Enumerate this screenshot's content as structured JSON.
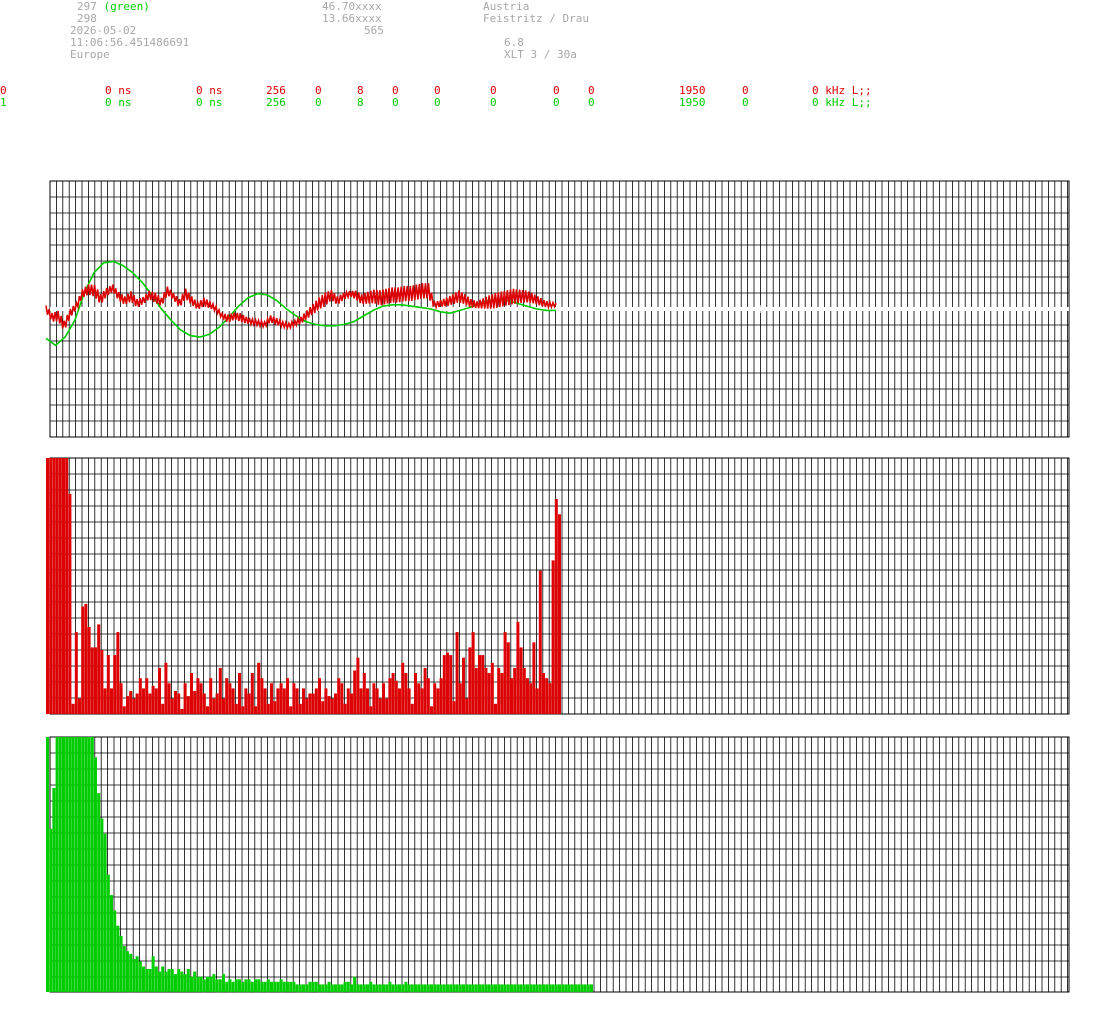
{
  "header": {
    "col1": [
      {
        "text": "297",
        "suffix": "(green)"
      },
      {
        "text": "298"
      },
      {
        "text": "2026-05-02"
      },
      {
        "text": "11:06:56.451486691"
      },
      {
        "text": "Europe"
      }
    ],
    "col2": [
      "46.70xxxx",
      "13.66xxxx",
      "565"
    ],
    "col3": [
      "Austria",
      "Feistritz / Drau",
      "",
      "6.8",
      "XLT 3 / 30a"
    ]
  },
  "channels": [
    {
      "id": "0",
      "d1": "0 ns",
      "d2": "0 ns",
      "n": "256",
      "a": "0",
      "b": "8",
      "c": "0",
      "d": "0",
      "e": "0",
      "f": "0",
      "g": "0",
      "h": "1950",
      "i": "0",
      "freq": "0 kHz L;;",
      "color": "#dd0000"
    },
    {
      "id": "1",
      "d1": "0 ns",
      "d2": "0 ns",
      "n": "256",
      "a": "0",
      "b": "8",
      "c": "0",
      "d": "0",
      "e": "0",
      "f": "0",
      "g": "0",
      "h": "1950",
      "i": "0",
      "freq": "0 kHz L;;",
      "color": "#00cc00"
    }
  ],
  "chart_data": [
    {
      "type": "line",
      "grid": true,
      "series": [
        {
          "color": "#dd0000",
          "values": [
            0,
            -0.6,
            -0.5,
            -1.2,
            -0.3,
            0.2,
            1.1,
            1.4,
            1.3,
            0.7,
            1.2,
            1.5,
            0.9,
            0.6,
            0.9,
            0.4,
            0.6,
            1.0,
            0.8,
            0.5,
            1.3,
            0.9,
            0.4,
            1.1,
            0.6,
            0.2,
            0.5,
            0.3,
            0.0,
            -0.5,
            -0.7,
            -0.5,
            -0.6,
            -0.8,
            -0.9,
            -1.0,
            -1.1,
            -0.7,
            -0.9,
            -1.1,
            -1.2,
            -1.0,
            -0.8,
            -0.4,
            0.0,
            0.4,
            0.7,
            1.0,
            0.6,
            0.9,
            1.1,
            1.0,
            0.7,
            0.8,
            0.9,
            0.8,
            0.9,
            1.0,
            1.0,
            1.1,
            1.1,
            1.2,
            1.3,
            1.3,
            0.3,
            0.4,
            0.5,
            0.7,
            0.9,
            0.7,
            0.4,
            0.3,
            0.4,
            0.5,
            0.6,
            0.7,
            0.8,
            0.9,
            0.9,
            0.9,
            0.8,
            0.6,
            0.4,
            0.3,
            0.3
          ],
          "amp": [
            0.4,
            0.5,
            0.6,
            0.6,
            0.5,
            0.4,
            0.5,
            0.6,
            0.7,
            0.6,
            0.5,
            0.4,
            0.5,
            0.5,
            0.6,
            0.5,
            0.4,
            0.5,
            0.6,
            0.5,
            0.5,
            0.4,
            0.5,
            0.6,
            0.5,
            0.4,
            0.5,
            0.4,
            0.3,
            0.3,
            0.5,
            0.4,
            0.5,
            0.4,
            0.3,
            0.3,
            0.3,
            0.4,
            0.4,
            0.3,
            0.3,
            0.3,
            0.4,
            0.5,
            0.6,
            0.7,
            0.8,
            0.6,
            0.5,
            0.4,
            0.3,
            0.5,
            0.6,
            0.7,
            0.8,
            0.9,
            0.9,
            0.9,
            0.9,
            0.9,
            0.9,
            0.9,
            0.9,
            0.9,
            0.3,
            0.4,
            0.5,
            0.6,
            0.7,
            0.6,
            0.5,
            0.4,
            0.6,
            0.8,
            0.9,
            0.9,
            0.9,
            0.9,
            0.8,
            0.7,
            0.6,
            0.5,
            0.4,
            0.3,
            0.2
          ]
        },
        {
          "color": "#00cc00",
          "values": [
            -2.1,
            -2.6,
            -2.0,
            -0.8,
            1.2,
            2.6,
            3.3,
            3.4,
            3.1,
            2.6,
            1.9,
            1.0,
            0.0,
            -0.8,
            -1.5,
            -1.9,
            -2.0,
            -1.8,
            -1.3,
            -0.6,
            0.2,
            0.8,
            1.1,
            1.0,
            0.6,
            0.0,
            -0.5,
            -0.9,
            -1.1,
            -1.2,
            -1.2,
            -1.1,
            -0.9,
            -0.5,
            -0.1,
            0.2,
            0.3,
            0.3,
            0.2,
            0.1,
            0.0,
            -0.2,
            -0.3,
            -0.1,
            0.1,
            0.4,
            0.6,
            0.7,
            0.6,
            0.4,
            0.2,
            0.0,
            -0.1,
            -0.1
          ]
        }
      ]
    },
    {
      "type": "bar",
      "color": "#dd0000",
      "ylim": [
        0,
        100
      ],
      "values": [
        100,
        100,
        100,
        100,
        100,
        100,
        100,
        86,
        4,
        32,
        6,
        42,
        43,
        34,
        26,
        26,
        35,
        25,
        10,
        23,
        10,
        23,
        32,
        12,
        3,
        7,
        9,
        6,
        8,
        14,
        10,
        14,
        8,
        11,
        10,
        18,
        4,
        20,
        12,
        6,
        9,
        8,
        2,
        12,
        7,
        16,
        9,
        14,
        12,
        8,
        3,
        14,
        6,
        8,
        18,
        6,
        14,
        12,
        10,
        4,
        16,
        3,
        10,
        8,
        16,
        3,
        20,
        14,
        10,
        4,
        12,
        5,
        10,
        12,
        10,
        14,
        3,
        12,
        10,
        4,
        10,
        6,
        8,
        8,
        10,
        14,
        5,
        10,
        7,
        6,
        8,
        14,
        12,
        4,
        10,
        8,
        17,
        22,
        10,
        16,
        10,
        3,
        12,
        10,
        6,
        12,
        6,
        14,
        16,
        13,
        10,
        20,
        16,
        10,
        4,
        16,
        12,
        10,
        18,
        14,
        3,
        12,
        10,
        14,
        23,
        24,
        23,
        5,
        32,
        12,
        22,
        6,
        26,
        32,
        18,
        23,
        23,
        18,
        16,
        20,
        4,
        18,
        16,
        32,
        28,
        14,
        18,
        36,
        26,
        18,
        14,
        12,
        28,
        10,
        56,
        16,
        14,
        12,
        60,
        84,
        78
      ]
    },
    {
      "type": "bar",
      "color": "#00cc00",
      "ylim": [
        0,
        100
      ],
      "values": [
        100,
        64,
        80,
        100,
        100,
        100,
        100,
        100,
        100,
        100,
        100,
        100,
        100,
        100,
        100,
        92,
        78,
        68,
        62,
        46,
        38,
        32,
        26,
        22,
        18,
        16,
        15,
        13,
        14,
        12,
        10,
        9,
        9,
        14,
        10,
        8,
        10,
        8,
        9,
        9,
        7,
        9,
        8,
        7,
        9,
        6,
        8,
        6,
        6,
        5,
        6,
        6,
        7,
        5,
        5,
        7,
        4,
        5,
        4,
        5,
        5,
        4,
        5,
        5,
        4,
        5,
        5,
        4,
        4,
        5,
        4,
        4,
        4,
        5,
        4,
        4,
        4,
        4,
        3,
        3,
        3,
        3,
        4,
        4,
        4,
        3,
        3,
        3,
        4,
        3,
        3,
        3,
        3,
        4,
        4,
        3,
        6,
        3,
        3,
        3,
        3,
        4,
        3,
        3,
        3,
        3,
        3,
        4,
        3,
        3,
        3,
        3,
        4,
        3,
        3,
        3,
        3,
        3,
        3,
        3,
        3,
        3,
        3,
        3,
        3,
        3,
        3,
        3,
        3,
        3,
        3,
        3,
        3,
        3,
        3,
        3,
        3,
        3,
        3,
        3,
        3,
        3,
        3,
        3,
        3,
        3,
        3,
        3,
        3,
        3,
        3,
        3,
        3,
        3,
        3,
        3,
        3,
        3,
        3,
        3,
        3,
        3,
        3,
        3,
        3,
        3,
        3,
        3,
        3,
        3,
        3
      ]
    }
  ]
}
